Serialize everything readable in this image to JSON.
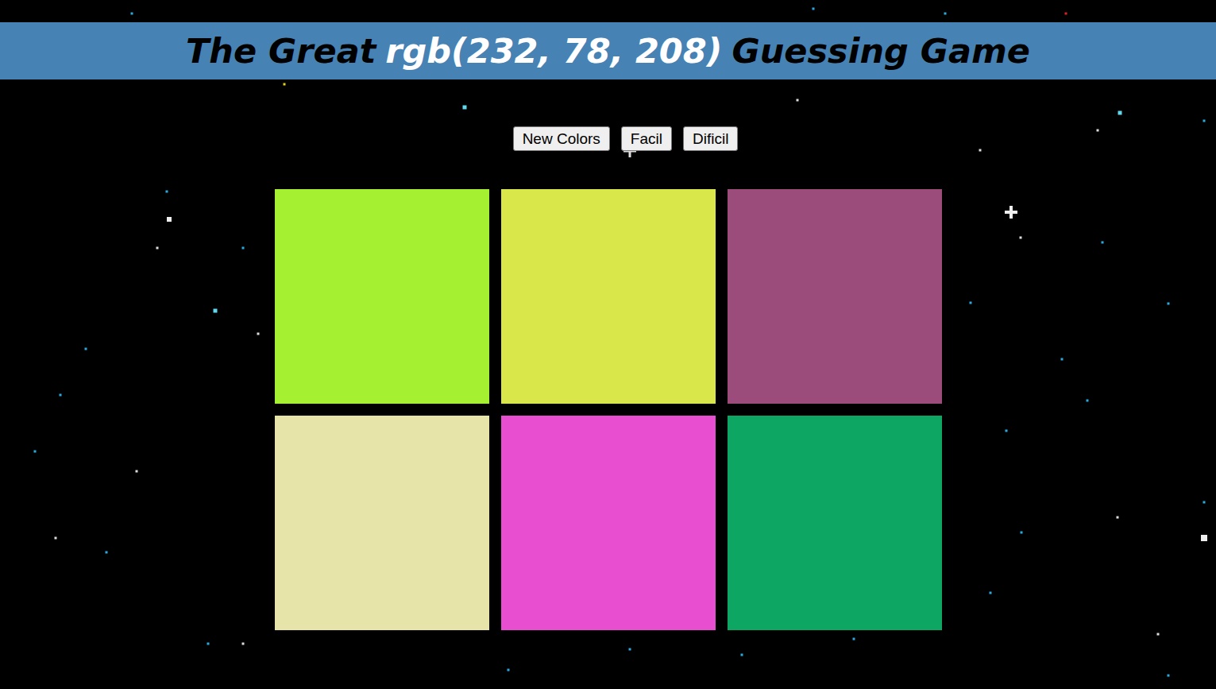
{
  "header": {
    "before": "The Great",
    "target": "rgb(232, 78, 208)",
    "after": "Guessing Game"
  },
  "buttons": [
    "New Colors",
    "Facil",
    "Dificil"
  ],
  "squares": [
    {
      "color": "#a6f032"
    },
    {
      "color": "#d9e74a"
    },
    {
      "color": "#9b4c7a"
    },
    {
      "color": "#e6e4a8"
    },
    {
      "color": "#e84ed0"
    },
    {
      "color": "#0ea663"
    }
  ]
}
